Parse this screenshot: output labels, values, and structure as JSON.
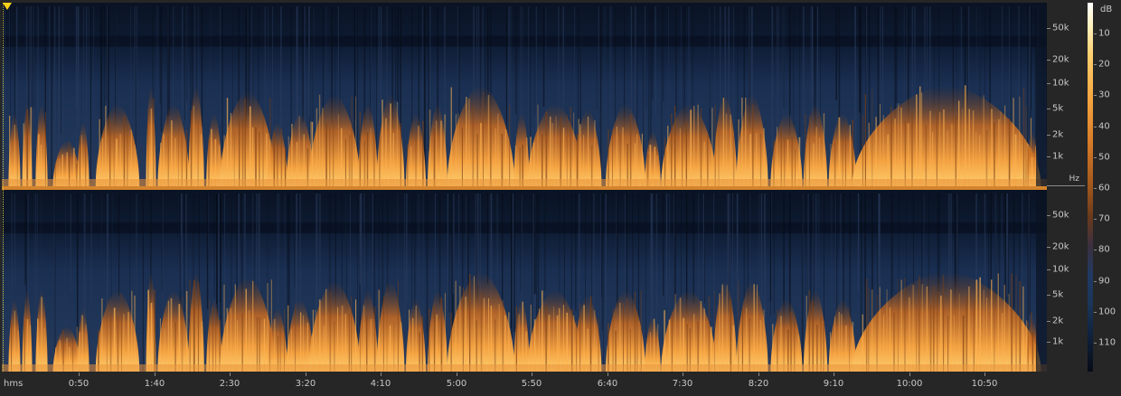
{
  "view": "spectral-frequency-display",
  "colors": {
    "background": "#0b1422",
    "low_energy": "#1a2f52",
    "mid_energy": "#c66a22",
    "high_energy": "#ffd070",
    "playhead": "#ffd21a",
    "axis_text": "#c8c8c8"
  },
  "freq_axis": {
    "unit": "Hz",
    "labels": [
      "50k",
      "20k",
      "10k",
      "5k",
      "2k",
      "1k"
    ]
  },
  "time_axis": {
    "unit": "hms",
    "labels": [
      "0:50",
      "1:40",
      "2:30",
      "3:20",
      "4:10",
      "5:00",
      "5:50",
      "6:40",
      "7:30",
      "8:20",
      "9:10",
      "10:00",
      "10:50"
    ]
  },
  "db_scale": {
    "unit": "dB",
    "labels": [
      "10",
      "20",
      "30",
      "40",
      "50",
      "60",
      "70",
      "80",
      "90",
      "100",
      "110"
    ]
  },
  "channels": 2,
  "playhead_icon": "playhead-triangle-icon"
}
